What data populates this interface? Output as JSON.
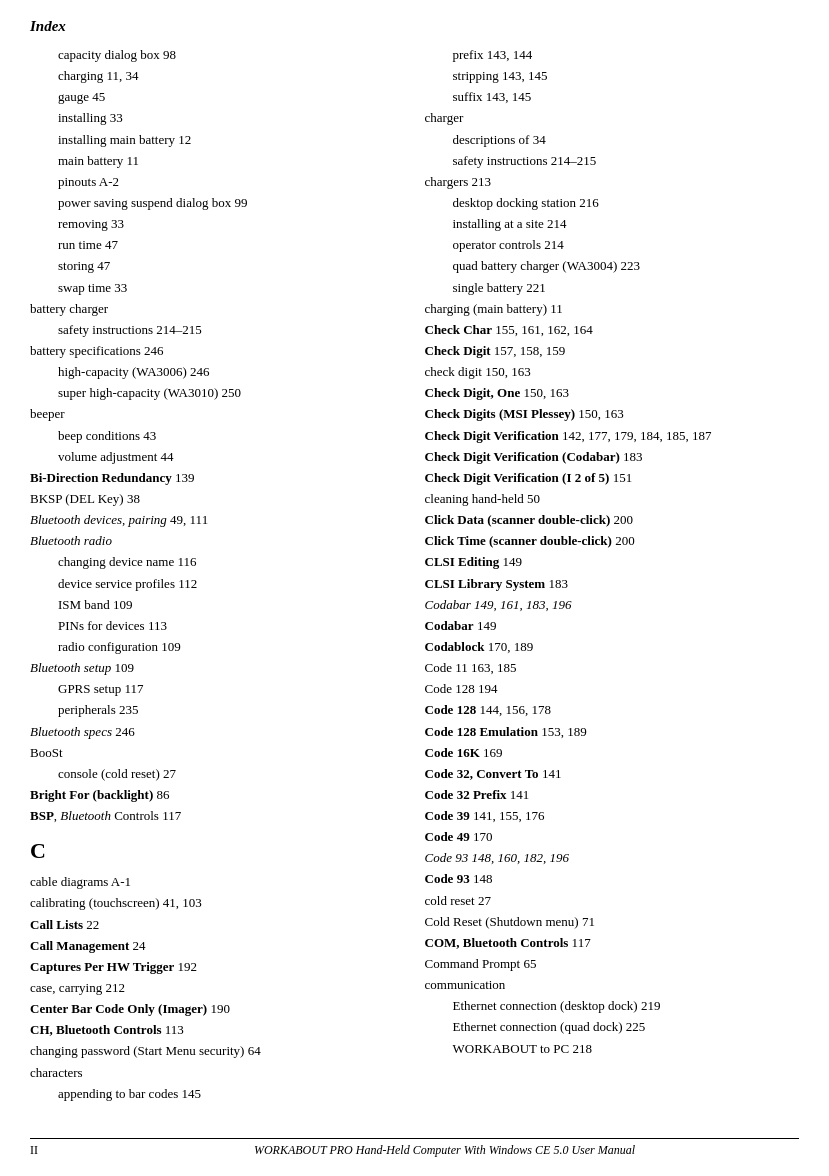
{
  "page": {
    "title": "Index"
  },
  "left_column": [
    {
      "text": "capacity dialog box   98",
      "style": "indent1"
    },
    {
      "text": "charging   11, 34",
      "style": "indent1"
    },
    {
      "text": "gauge   45",
      "style": "indent1"
    },
    {
      "text": "installing   33",
      "style": "indent1"
    },
    {
      "text": "installing main battery   12",
      "style": "indent1"
    },
    {
      "text": "main battery   11",
      "style": "indent1"
    },
    {
      "text": "pinouts   A-2",
      "style": "indent1"
    },
    {
      "text": "power saving suspend dialog box   99",
      "style": "indent1"
    },
    {
      "text": "removing   33",
      "style": "indent1"
    },
    {
      "text": "run time   47",
      "style": "indent1"
    },
    {
      "text": "storing   47",
      "style": "indent1"
    },
    {
      "text": "swap time   33",
      "style": "indent1"
    },
    {
      "text": "battery charger",
      "style": "normal"
    },
    {
      "text": "safety instructions   214–215",
      "style": "indent1"
    },
    {
      "text": "battery specifications   246",
      "style": "normal"
    },
    {
      "text": "high-capacity (WA3006)   246",
      "style": "indent1"
    },
    {
      "text": "super high-capacity (WA3010)   250",
      "style": "indent1"
    },
    {
      "text": "beeper",
      "style": "normal"
    },
    {
      "text": "beep conditions   43",
      "style": "indent1"
    },
    {
      "text": "volume adjustment   44",
      "style": "indent1"
    },
    {
      "text": "Bi-Direction Redundancy   139",
      "style": "bold"
    },
    {
      "text": "BKSP (DEL Key)   38",
      "style": "normal"
    },
    {
      "text": "Bluetooth devices, pairing   49, 111",
      "style": "italic"
    },
    {
      "text": "Bluetooth radio",
      "style": "italic"
    },
    {
      "text": "changing device name   116",
      "style": "indent1"
    },
    {
      "text": "device service profiles   112",
      "style": "indent1"
    },
    {
      "text": "ISM band   109",
      "style": "indent1"
    },
    {
      "text": "PINs for devices   113",
      "style": "indent1"
    },
    {
      "text": "radio configuration   109",
      "style": "indent1"
    },
    {
      "text": "Bluetooth setup   109",
      "style": "italic"
    },
    {
      "text": "GPRS setup   117",
      "style": "indent1"
    },
    {
      "text": "peripherals   235",
      "style": "indent1"
    },
    {
      "text": "Bluetooth specs   246",
      "style": "italic"
    },
    {
      "text": "BooSt",
      "style": "normal"
    },
    {
      "text": "console (cold reset)   27",
      "style": "indent1"
    },
    {
      "text": "Bright For (backlight)   86",
      "style": "bold"
    },
    {
      "text": "BSP, Bluetooth Controls   117",
      "style": "bold-bsp"
    },
    {
      "text": "C",
      "style": "section"
    },
    {
      "text": "cable diagrams   A-1",
      "style": "normal"
    },
    {
      "text": "calibrating (touchscreen)   41, 103",
      "style": "normal"
    },
    {
      "text": "Call Lists   22",
      "style": "bold"
    },
    {
      "text": "Call Management   24",
      "style": "bold"
    },
    {
      "text": "Captures Per HW Trigger   192",
      "style": "bold"
    },
    {
      "text": "case, carrying   212",
      "style": "normal"
    },
    {
      "text": "Center Bar Code Only (Imager)   190",
      "style": "bold"
    },
    {
      "text": "CH, Bluetooth Controls   113",
      "style": "bold"
    },
    {
      "text": "changing password (Start Menu security)   64",
      "style": "normal"
    },
    {
      "text": "characters",
      "style": "normal"
    },
    {
      "text": "appending to bar codes   145",
      "style": "indent1"
    }
  ],
  "right_column": [
    {
      "text": "prefix   143, 144",
      "style": "indent1"
    },
    {
      "text": "stripping   143, 145",
      "style": "indent1"
    },
    {
      "text": "suffix   143, 145",
      "style": "indent1"
    },
    {
      "text": "charger",
      "style": "normal"
    },
    {
      "text": "descriptions of   34",
      "style": "indent1"
    },
    {
      "text": "safety instructions   214–215",
      "style": "indent1"
    },
    {
      "text": "chargers   213",
      "style": "normal"
    },
    {
      "text": "desktop docking station   216",
      "style": "indent1"
    },
    {
      "text": "installing at a site   214",
      "style": "indent1"
    },
    {
      "text": "operator controls   214",
      "style": "indent1"
    },
    {
      "text": "quad battery charger (WA3004)   223",
      "style": "indent1"
    },
    {
      "text": "single battery   221",
      "style": "indent1"
    },
    {
      "text": "charging (main battery)   11",
      "style": "normal"
    },
    {
      "text": "Check Char   155, 161, 162, 164",
      "style": "bold"
    },
    {
      "text": "Check Digit   157, 158, 159",
      "style": "bold"
    },
    {
      "text": "check digit   150, 163",
      "style": "normal"
    },
    {
      "text": "Check Digit, One   150, 163",
      "style": "bold"
    },
    {
      "text": "Check Digits (MSI Plessey)   150, 163",
      "style": "bold"
    },
    {
      "text": "Check Digit Verification   142, 177, 179, 184, 185, 187",
      "style": "bold"
    },
    {
      "text": "Check Digit Verification (Codabar)   183",
      "style": "bold"
    },
    {
      "text": "Check Digit Verification (I 2 of 5)   151",
      "style": "bold"
    },
    {
      "text": "cleaning hand-held   50",
      "style": "normal"
    },
    {
      "text": "Click Data (scanner double-click)   200",
      "style": "bold"
    },
    {
      "text": "Click Time (scanner double-click)   200",
      "style": "bold"
    },
    {
      "text": "CLSI Editing   149",
      "style": "bold"
    },
    {
      "text": "CLSI Library System   183",
      "style": "bold"
    },
    {
      "text": "Codabar   149, 161, 183, 196",
      "style": "italic"
    },
    {
      "text": "Codabar   149",
      "style": "bold"
    },
    {
      "text": "Codablock   170, 189",
      "style": "bold"
    },
    {
      "text": "Code 11   163, 185",
      "style": "normal"
    },
    {
      "text": "Code 128   194",
      "style": "normal"
    },
    {
      "text": "Code 128   144, 156, 178",
      "style": "bold"
    },
    {
      "text": "Code 128 Emulation   153, 189",
      "style": "bold"
    },
    {
      "text": "Code 16K   169",
      "style": "bold"
    },
    {
      "text": "Code 32, Convert To   141",
      "style": "bold"
    },
    {
      "text": "Code 32 Prefix   141",
      "style": "bold"
    },
    {
      "text": "Code 39   141, 155, 176",
      "style": "bold"
    },
    {
      "text": "Code 49   170",
      "style": "bold"
    },
    {
      "text": "Code 93   148, 160, 182, 196",
      "style": "italic"
    },
    {
      "text": "Code 93   148",
      "style": "bold"
    },
    {
      "text": "cold reset   27",
      "style": "normal"
    },
    {
      "text": "Cold Reset (Shutdown menu)   71",
      "style": "normal"
    },
    {
      "text": "COM, Bluetooth Controls   117",
      "style": "bold"
    },
    {
      "text": "Command Prompt   65",
      "style": "normal"
    },
    {
      "text": "communication",
      "style": "normal"
    },
    {
      "text": "Ethernet connection (desktop dock)   219",
      "style": "indent1"
    },
    {
      "text": "Ethernet connection (quad dock)   225",
      "style": "indent1"
    },
    {
      "text": "WORKABOUT to PC   218",
      "style": "indent1"
    }
  ],
  "footer": {
    "page_num": "II",
    "text": "WORKABOUT PRO Hand-Held Computer With Windows CE 5.0 User Manual"
  }
}
